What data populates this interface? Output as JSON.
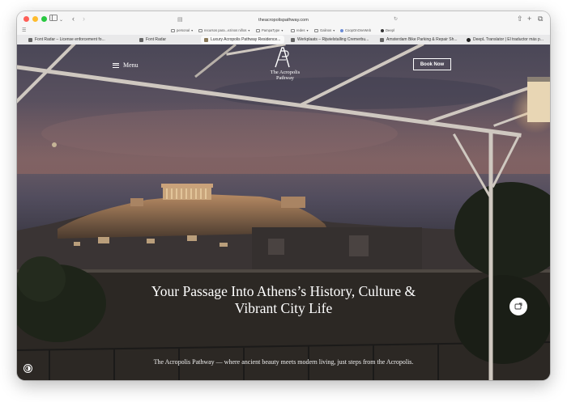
{
  "browser": {
    "url": "theacropolispathway.com",
    "sidebar_icon": "sidebar-icon",
    "back_icon": "back-arrow-icon",
    "forward_icon": "forward-arrow-icon"
  },
  "bookmarks": [
    {
      "label": "personal",
      "icon": "folder-icon"
    },
    {
      "label": "recursos para...ezinos niños",
      "icon": "folder-icon"
    },
    {
      "label": "PampaType",
      "icon": "folder-icon"
    },
    {
      "label": "redes",
      "icon": "folder-icon"
    },
    {
      "label": "Galinos",
      "icon": "folder-icon"
    },
    {
      "label": "CoopOnOneWeb",
      "icon": "site-icon"
    },
    {
      "label": "Deepl",
      "icon": "site-icon"
    }
  ],
  "tabs": [
    {
      "label": "Font Radar – License enforcement fo..."
    },
    {
      "label": "Font Radar"
    },
    {
      "label": "Luxury Acropolis Pathway Residence..."
    },
    {
      "label": "Werkplaats – Rijwielstalling Cremerbu..."
    },
    {
      "label": "Amsterdam Bike Parking & Repair Sh..."
    },
    {
      "label": "DeepL Translator | El traductor más p..."
    }
  ],
  "site": {
    "menu_label": "Menu",
    "logo_line1": "The Acropolis",
    "logo_line2": "Pathway",
    "book_label": "Book Now",
    "headline_line1": "Your Passage Into Athens’s History, Culture &",
    "headline_line2": "Vibrant City Life",
    "subline": "The Acropolis Pathway — where ancient beauty meets modern living, just steps from the Acropolis."
  },
  "colors": {
    "accent": "#ffffff",
    "sky_top": "#4a4757",
    "sky_glow": "#6a5c66",
    "traffic_red": "#ff5f57",
    "traffic_yellow": "#febc2e",
    "traffic_green": "#28c840"
  }
}
